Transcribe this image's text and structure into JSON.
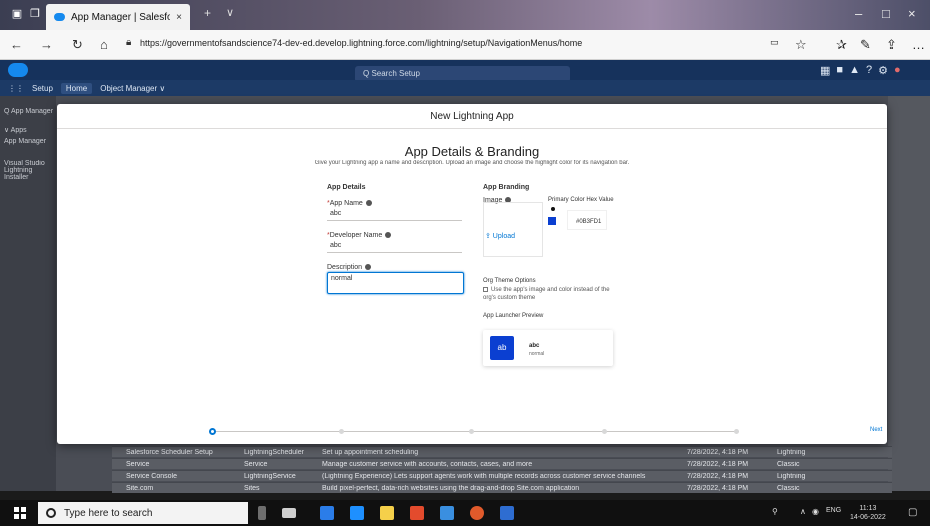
{
  "browser": {
    "tab_title": "App Manager | Salesfor",
    "tab_close": "×",
    "url": "https://governmentofsandscience74-dev-ed.develop.lightning.force.com/lightning/setup/NavigationMenus/home",
    "icons": [
      "back-icon",
      "forward-icon",
      "refresh-icon",
      "home-icon",
      "star-icon",
      "favorites-icon",
      "pen-icon",
      "share-icon",
      "more-icon"
    ]
  },
  "salesforce": {
    "search_placeholder": "Q  Search Setup",
    "setup_label": "Setup",
    "home_tab": "Home",
    "object_manager_tab": "Object Manager ∨",
    "sidebar_items": [
      "Q  App Manager",
      "∨ Apps",
      "App Manager",
      "Visual Studio Lightning Installer"
    ]
  },
  "background_rows": [
    {
      "name": "Salesforce Scheduler Setup",
      "dev": "LightningScheduler",
      "desc": "Set up appointment scheduling",
      "date": "7/28/2022, 4:18 PM",
      "type": "Lightning"
    },
    {
      "name": "Service",
      "dev": "Service",
      "desc": "Manage customer service with accounts, contacts, cases, and more",
      "date": "7/28/2022, 4:18 PM",
      "type": "Classic"
    },
    {
      "name": "Service Console",
      "dev": "LightningService",
      "desc": "(Lightning Experience) Lets support agents work with multiple records across customer service channels",
      "date": "7/28/2022, 4:18 PM",
      "type": "Lightning"
    },
    {
      "name": "Site.com",
      "dev": "Sites",
      "desc": "Build pixel-perfect, data-rich websites using the drag-and-drop Site.com application",
      "date": "7/28/2022, 4:18 PM",
      "type": "Classic"
    }
  ],
  "modal": {
    "header": "New Lightning App",
    "title": "App Details & Branding",
    "description": "Give your Lightning app a name and description. Upload an image and choose the highlight color for its navigation bar.",
    "app_details_section": "App Details",
    "app_name_label": "App Name",
    "app_name_value": "abc",
    "developer_name_label": "Developer Name",
    "developer_name_value": "abc",
    "description_label": "Description",
    "description_value": "normal",
    "branding_section": "App Branding",
    "image_label": "Image",
    "upload_label": "⇪ Upload",
    "primary_color_label": "Primary Color Hex Value",
    "primary_color": "#0B3FD1",
    "org_theme_label": "Org Theme Options",
    "org_theme_checkbox": "Use the app's image and color instead of the org's custom theme",
    "preview_label": "App Launcher Preview",
    "preview_tile": "ab",
    "preview_name": "abc",
    "preview_desc": "normal",
    "next_label": "Next"
  },
  "taskbar": {
    "search_placeholder": "Type here to search",
    "time": "11:13",
    "date": "14-06-2022",
    "lang": "ENG"
  }
}
